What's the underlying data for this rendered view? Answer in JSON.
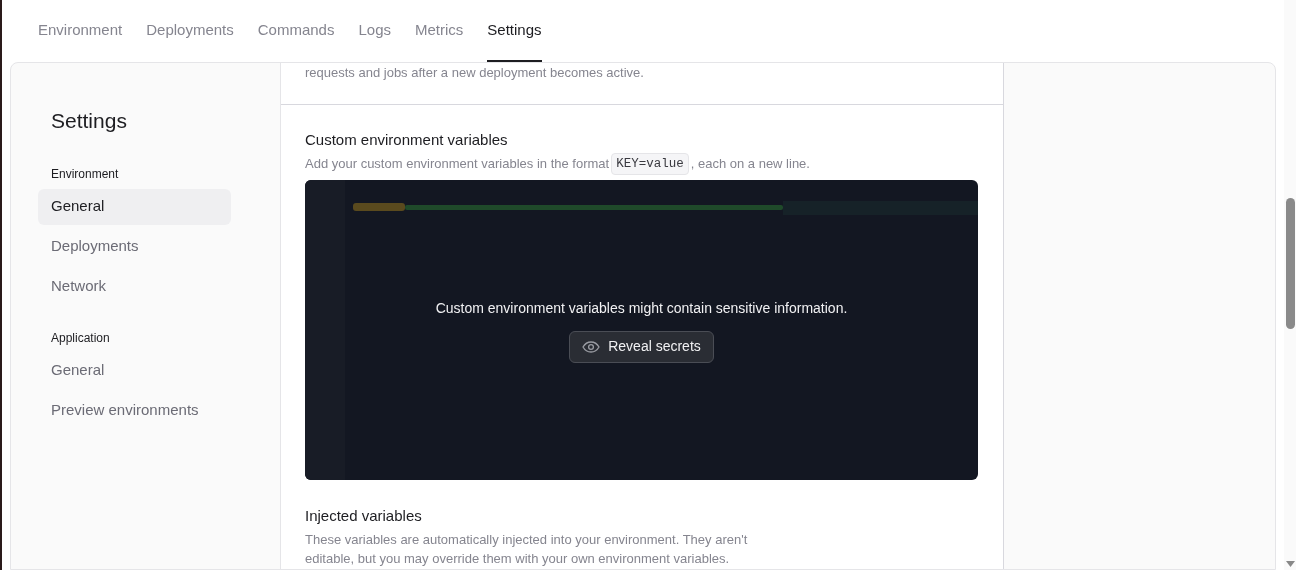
{
  "tabs": [
    {
      "label": "Environment",
      "selected": false
    },
    {
      "label": "Deployments",
      "selected": false
    },
    {
      "label": "Commands",
      "selected": false
    },
    {
      "label": "Logs",
      "selected": false
    },
    {
      "label": "Metrics",
      "selected": false
    },
    {
      "label": "Settings",
      "selected": true
    }
  ],
  "sidebar": {
    "title": "Settings",
    "groups": [
      {
        "heading": "Environment",
        "items": [
          {
            "label": "General",
            "selected": true
          },
          {
            "label": "Deployments",
            "selected": false
          },
          {
            "label": "Network",
            "selected": false
          }
        ]
      },
      {
        "heading": "Application",
        "items": [
          {
            "label": "General",
            "selected": false
          },
          {
            "label": "Preview environments",
            "selected": false
          }
        ]
      }
    ]
  },
  "previous_section_text": "requests and jobs after a new deployment becomes active.",
  "custom_variables": {
    "title": "Custom environment variables",
    "description_before": "Add your custom environment variables in the format",
    "code": "KEY=value",
    "description_after": ", each on a new line.",
    "overlay_message": "Custom environment variables might contain sensitive information.",
    "reveal_button": "Reveal secrets"
  },
  "injected_variables": {
    "title": "Injected variables",
    "description": "These variables are automatically injected into your environment. They aren't editable, but you may override them with your own environment variables."
  }
}
